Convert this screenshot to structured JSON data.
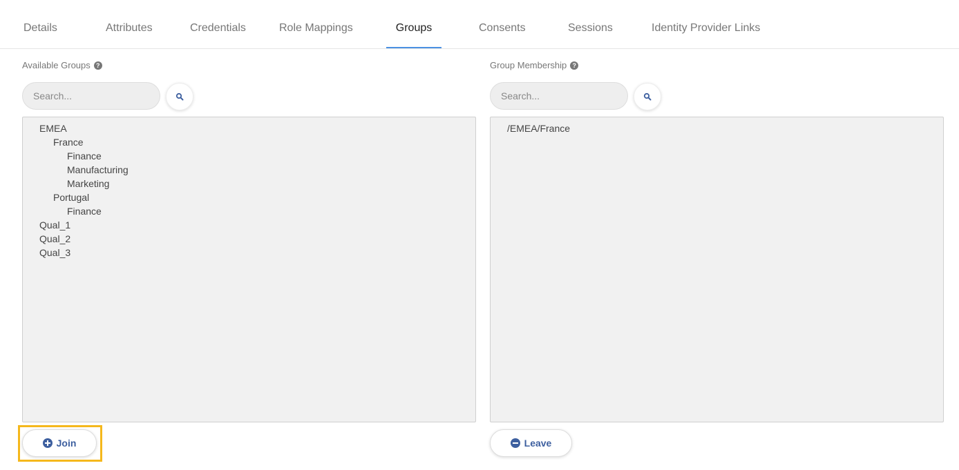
{
  "tabs": [
    {
      "label": "Details"
    },
    {
      "label": "Attributes"
    },
    {
      "label": "Credentials"
    },
    {
      "label": "Role Mappings"
    },
    {
      "label": "Groups",
      "active": true
    },
    {
      "label": "Consents"
    },
    {
      "label": "Sessions"
    },
    {
      "label": "Identity Provider Links"
    }
  ],
  "available": {
    "label": "Available Groups",
    "search_placeholder": "Search...",
    "groups": [
      {
        "name": "EMEA",
        "level": 0
      },
      {
        "name": "France",
        "level": 1
      },
      {
        "name": "Finance",
        "level": 2
      },
      {
        "name": "Manufacturing",
        "level": 2
      },
      {
        "name": "Marketing",
        "level": 2
      },
      {
        "name": "Portugal",
        "level": 1
      },
      {
        "name": "Finance",
        "level": 2
      },
      {
        "name": "Qual_1",
        "level": 0
      },
      {
        "name": "Qual_2",
        "level": 0
      },
      {
        "name": "Qual_3",
        "level": 0
      }
    ],
    "join_label": "Join"
  },
  "membership": {
    "label": "Group Membership",
    "search_placeholder": "Search...",
    "groups": [
      "/EMEA/France"
    ],
    "leave_label": "Leave"
  },
  "colors": {
    "accent": "#4a90e2",
    "button_text": "#3d5f9f",
    "highlight": "#f5b81c"
  }
}
